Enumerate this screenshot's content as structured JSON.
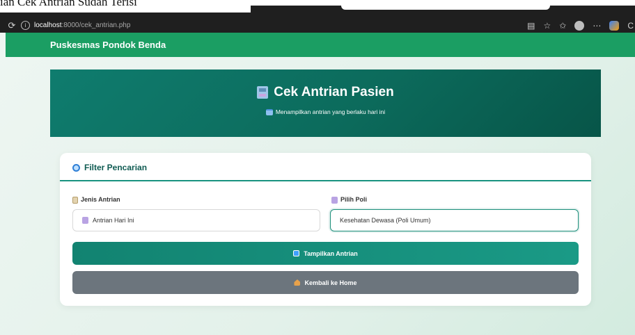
{
  "caption": "ian Cek Antrian Sudah Terisi",
  "browser": {
    "url_host": "localhost",
    "url_path": ":8000/cek_antrian.php"
  },
  "navbar": {
    "brand": "Puskesmas Pondok Benda"
  },
  "hero": {
    "title": "Cek Antrian Pasien",
    "subtitle": "Menampilkan antrian yang berlaku hari ini"
  },
  "filter": {
    "title": "Filter Pencarian",
    "jenis_label": "Jenis Antrian",
    "jenis_value": "Antrian Hari Ini",
    "poli_label": "Pilih Poli",
    "poli_value": "Kesehatan Dewasa (Poli Umum)",
    "show_button": "Tampilkan Antrian",
    "home_button": "Kembali ke Home"
  },
  "colors": {
    "navbar": "#1b9e63",
    "hero": "#0c6b5c",
    "primary_button": "#128371",
    "secondary_button": "#6c757d"
  }
}
